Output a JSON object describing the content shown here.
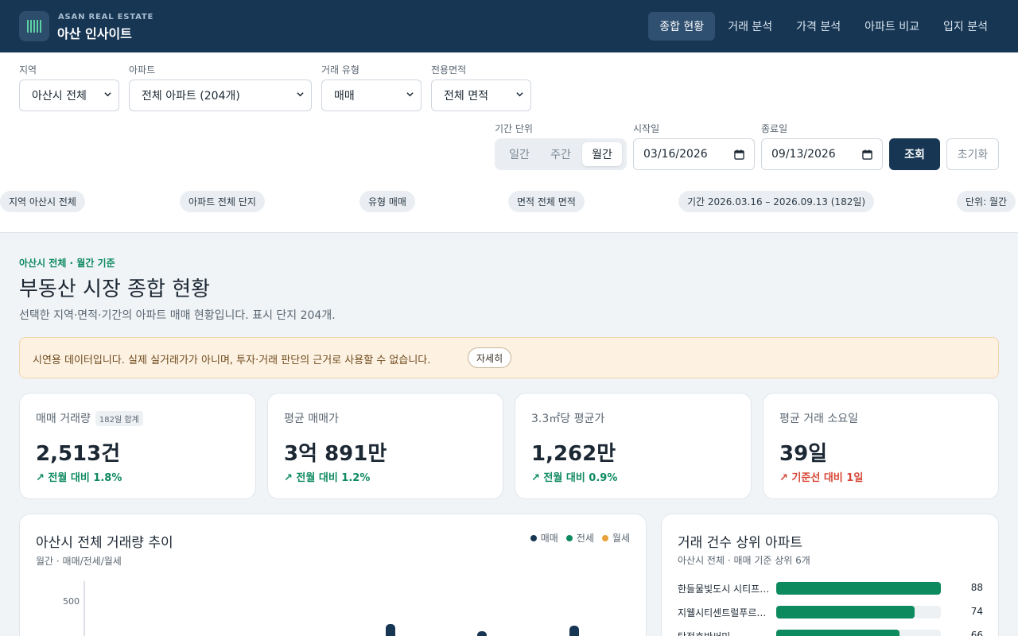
{
  "brand": {
    "subtitle": "ASAN REAL ESTATE",
    "title": "아산 인사이트"
  },
  "nav": [
    {
      "label": "종합 현황",
      "active": true
    },
    {
      "label": "거래 분석",
      "active": false
    },
    {
      "label": "가격 분석",
      "active": false
    },
    {
      "label": "아파트 비교",
      "active": false
    },
    {
      "label": "입지 분석",
      "active": false
    }
  ],
  "filters": {
    "region": {
      "label": "지역",
      "value": "아산시 전체"
    },
    "apartment": {
      "label": "아파트",
      "value": "전체 아파트 (204개)"
    },
    "deal_type": {
      "label": "거래 유형",
      "value": "매매"
    },
    "area": {
      "label": "전용면적",
      "value": "전체 면적"
    },
    "period_unit": {
      "label": "기간 단위",
      "options": [
        "일간",
        "주간",
        "월간"
      ],
      "selected": "월간"
    },
    "start": {
      "label": "시작일",
      "value": "03/16/2026"
    },
    "end": {
      "label": "종료일",
      "value": "09/13/2026"
    },
    "search_label": "조회",
    "reset_label": "초기화"
  },
  "chips": [
    "지역 아산시 전체",
    "아파트 전체 단지",
    "유형 매매",
    "면적 전체 면적",
    "기간 2026.03.16 – 2026.09.13 (182일)",
    "단위: 월간"
  ],
  "header": {
    "eyebrow": "아산시 전체 · 월간 기준",
    "title": "부동산 시장 종합 현황",
    "description": "선택한 지역·면적·기간의 아파트 매매 현황입니다. 표시 단지 204개."
  },
  "notice": {
    "text": "시연용 데이터입니다.  실제 실거래가가 아니며, 투자·거래 판단의 근거로 사용할 수 없습니다.",
    "button": "자세히"
  },
  "kpis": [
    {
      "label": "매매 거래량",
      "badge": "182일 합계",
      "value": "2,513건",
      "delta": "↗ 전월 대비 1.8%",
      "tone": "up"
    },
    {
      "label": "평균 매매가",
      "badge": "",
      "value": "3억 891만",
      "delta": "↗ 전월 대비 1.2%",
      "tone": "up"
    },
    {
      "label": "3.3㎡당 평균가",
      "badge": "",
      "value": "1,262만",
      "delta": "↗ 전월 대비 0.9%",
      "tone": "up"
    },
    {
      "label": "평균 거래 소요일",
      "badge": "",
      "value": "39일",
      "delta": "↗ 기준선 대비 1일",
      "tone": "warn"
    }
  ],
  "colors": {
    "sale": "#163654",
    "jeonse": "#0e8a5f",
    "monthly": "#e9a23b"
  },
  "chart_data": {
    "type": "bar",
    "title": "아산시 전체 거래량 추이",
    "subtitle": "월간 · 매매/전세/월세",
    "legend": [
      "매매",
      "전세",
      "월세"
    ],
    "legend_position": "top-right",
    "y_ticks": [
      "500"
    ],
    "ylim": [
      0,
      500
    ]
  },
  "top_list": {
    "title": "거래 건수 상위 아파트",
    "subtitle": "아산시 전체 · 매매 기준 상위 6개",
    "max": 88,
    "items": [
      {
        "name": "한들물빛도시 시티프라디움",
        "value": 88
      },
      {
        "name": "지웰시티센트럴푸르지오",
        "value": 74
      },
      {
        "name": "탕정호반써밋",
        "value": 66
      }
    ]
  }
}
